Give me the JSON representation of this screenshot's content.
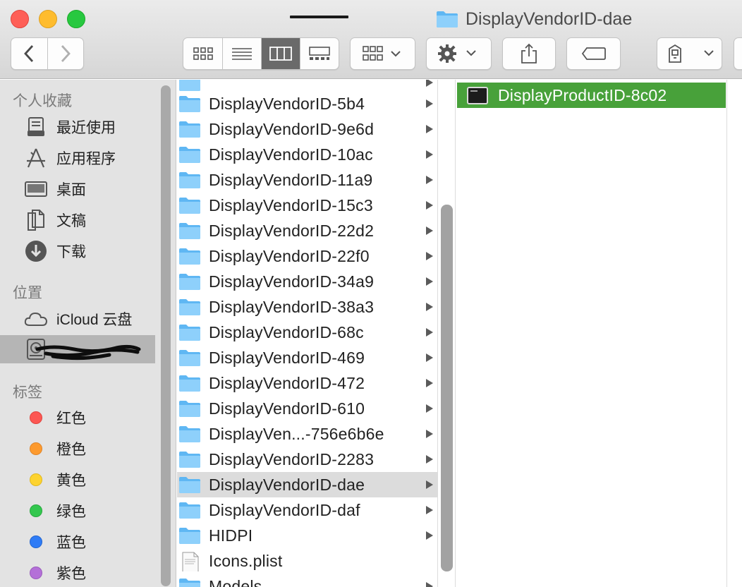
{
  "window": {
    "title": "DisplayVendorID-dae"
  },
  "toolbar": {
    "back_icon": "chevron-left-icon",
    "forward_icon": "chevron-right-icon",
    "view_modes": [
      "icon-view",
      "list-view",
      "column-view",
      "gallery-view"
    ],
    "active_view": "column-view"
  },
  "sidebar": {
    "favorites_header": "个人收藏",
    "favorites": [
      {
        "label": "最近使用",
        "icon": "recents-icon"
      },
      {
        "label": "应用程序",
        "icon": "applications-icon"
      },
      {
        "label": "桌面",
        "icon": "desktop-icon"
      },
      {
        "label": "文稿",
        "icon": "documents-icon"
      },
      {
        "label": "下载",
        "icon": "downloads-icon"
      }
    ],
    "locations_header": "位置",
    "locations": [
      {
        "label": "iCloud 云盘",
        "icon": "cloud-icon"
      },
      {
        "label": "",
        "icon": "disk-icon",
        "redacted": true
      }
    ],
    "tags_header": "标签",
    "tags": [
      {
        "label": "红色",
        "color": "#fc5753"
      },
      {
        "label": "橙色",
        "color": "#fd9a2e"
      },
      {
        "label": "黄色",
        "color": "#fdd32f"
      },
      {
        "label": "绿色",
        "color": "#33c74e"
      },
      {
        "label": "蓝色",
        "color": "#2f7cf6"
      },
      {
        "label": "紫色",
        "color": "#b470d8"
      }
    ]
  },
  "column1": {
    "items": [
      {
        "name": "DisplayVendorID-5b4",
        "type": "folder"
      },
      {
        "name": "DisplayVendorID-9e6d",
        "type": "folder"
      },
      {
        "name": "DisplayVendorID-10ac",
        "type": "folder"
      },
      {
        "name": "DisplayVendorID-11a9",
        "type": "folder"
      },
      {
        "name": "DisplayVendorID-15c3",
        "type": "folder"
      },
      {
        "name": "DisplayVendorID-22d2",
        "type": "folder"
      },
      {
        "name": "DisplayVendorID-22f0",
        "type": "folder"
      },
      {
        "name": "DisplayVendorID-34a9",
        "type": "folder"
      },
      {
        "name": "DisplayVendorID-38a3",
        "type": "folder"
      },
      {
        "name": "DisplayVendorID-68c",
        "type": "folder"
      },
      {
        "name": "DisplayVendorID-469",
        "type": "folder"
      },
      {
        "name": "DisplayVendorID-472",
        "type": "folder"
      },
      {
        "name": "DisplayVendorID-610",
        "type": "folder"
      },
      {
        "name": "DisplayVen...-756e6b6e",
        "type": "folder"
      },
      {
        "name": "DisplayVendorID-2283",
        "type": "folder"
      },
      {
        "name": "DisplayVendorID-dae",
        "type": "folder",
        "selected": true
      },
      {
        "name": "DisplayVendorID-daf",
        "type": "folder"
      },
      {
        "name": "HIDPI",
        "type": "folder"
      },
      {
        "name": "Icons.plist",
        "type": "file"
      },
      {
        "name": "Models",
        "type": "folder"
      }
    ]
  },
  "column2": {
    "items": [
      {
        "name": "DisplayProductID-8c02",
        "type": "exec",
        "selected": true
      }
    ]
  }
}
